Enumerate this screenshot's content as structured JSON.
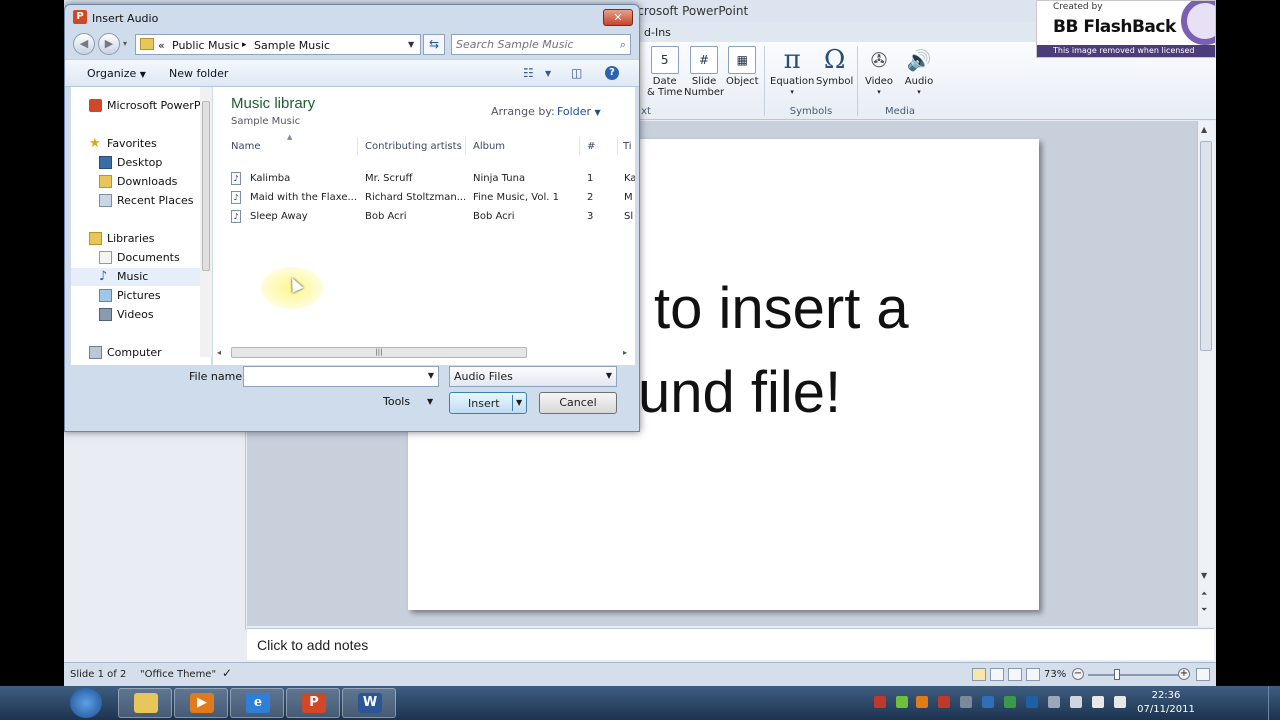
{
  "ppt": {
    "title_fragment": "icrosoft PowerPoint",
    "tab_fragment": "d-Ins",
    "ribbon": {
      "buttons": [
        {
          "label_line1": "Date",
          "label_line2": "& Time",
          "icon": "calendar-icon"
        },
        {
          "label_line1": "Slide",
          "label_line2": "Number",
          "icon": "slide-number-icon"
        },
        {
          "label_line1": "Object",
          "label_line2": "",
          "icon": "object-icon"
        },
        {
          "label_line1": "Equation",
          "label_line2": "",
          "icon": "pi-icon"
        },
        {
          "label_line1": "Symbol",
          "label_line2": "",
          "icon": "omega-icon"
        },
        {
          "label_line1": "Video",
          "label_line2": "",
          "icon": "film-reel-icon"
        },
        {
          "label_line1": "Audio",
          "label_line2": "",
          "icon": "speaker-icon"
        }
      ],
      "groups": {
        "text_fragment": "xt",
        "symbols": "Symbols",
        "media": "Media"
      }
    },
    "slide_text_line1": "to insert a",
    "slide_text_line2": "und file!",
    "notes_placeholder": "Click to add notes",
    "status": {
      "slide": "Slide 1 of 2",
      "theme": "\"Office Theme\"",
      "zoom": "73%"
    }
  },
  "watermark": {
    "created_by": "Created by",
    "name": "BB FlashBack",
    "notice": "This image removed when licensed"
  },
  "dialog": {
    "title": "Insert Audio",
    "close_glyph": "✕",
    "breadcrumb": {
      "overflow": "«",
      "part1": "Public Music",
      "sep": "▸",
      "part2": "Sample Music"
    },
    "search_placeholder": "Search Sample Music",
    "toolbar": {
      "organize": "Organize",
      "new_folder": "New folder"
    },
    "nav": {
      "items": [
        {
          "label": "Microsoft PowerPo",
          "icon": "powerpoint-icon",
          "indent": 0
        },
        {
          "label": "Favorites",
          "icon": "star-icon",
          "indent": 0
        },
        {
          "label": "Desktop",
          "icon": "desktop-icon",
          "indent": 1
        },
        {
          "label": "Downloads",
          "icon": "downloads-folder-icon",
          "indent": 1
        },
        {
          "label": "Recent Places",
          "icon": "recent-places-icon",
          "indent": 1
        },
        {
          "label": "Libraries",
          "icon": "libraries-icon",
          "indent": 0
        },
        {
          "label": "Documents",
          "icon": "documents-icon",
          "indent": 1
        },
        {
          "label": "Music",
          "icon": "music-note-icon",
          "indent": 1
        },
        {
          "label": "Pictures",
          "icon": "pictures-icon",
          "indent": 1
        },
        {
          "label": "Videos",
          "icon": "videos-icon",
          "indent": 1
        },
        {
          "label": "Computer",
          "icon": "computer-icon",
          "indent": 0
        }
      ]
    },
    "library": {
      "title": "Music library",
      "subtitle": "Sample Music",
      "arrange_label": "Arrange by:",
      "arrange_value": "Folder"
    },
    "columns": [
      "Name",
      "Contributing artists",
      "Album",
      "#",
      "Ti"
    ],
    "rows": [
      {
        "name": "Kalimba",
        "artist": "Mr. Scruff",
        "album": "Ninja Tuna",
        "num": "1",
        "title": "Ka"
      },
      {
        "name": "Maid with the Flaxe...",
        "artist": "Richard Stoltzman...",
        "album": "Fine Music, Vol. 1",
        "num": "2",
        "title": "M"
      },
      {
        "name": "Sleep Away",
        "artist": "Bob Acri",
        "album": "Bob Acri",
        "num": "3",
        "title": "Sl"
      }
    ],
    "file_name_label": "File name:",
    "file_name_value": "",
    "file_type": "Audio Files",
    "tools": "Tools",
    "insert": "Insert",
    "cancel": "Cancel"
  },
  "taskbar": {
    "time": "22:36",
    "date": "07/11/2011"
  }
}
